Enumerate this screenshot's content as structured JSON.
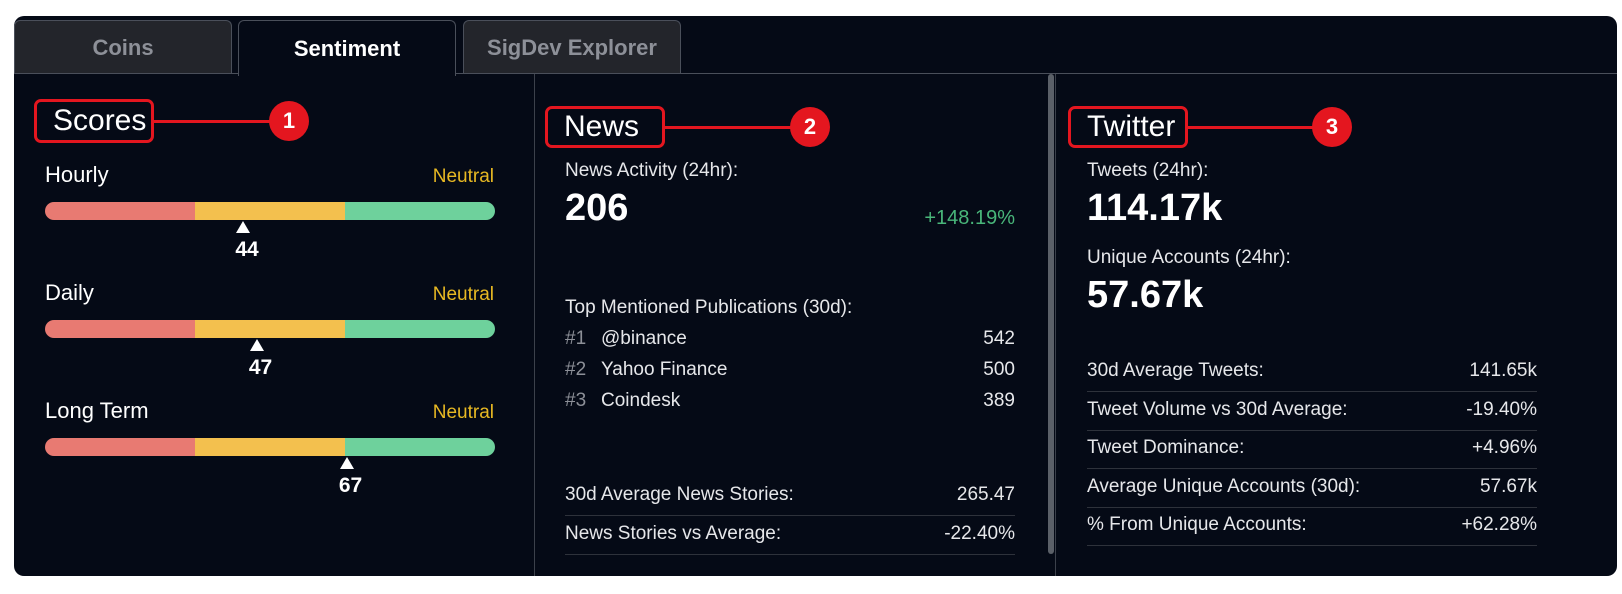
{
  "tabs": [
    {
      "label": "Coins",
      "active": false
    },
    {
      "label": "Sentiment",
      "active": true
    },
    {
      "label": "SigDev Explorer",
      "active": false
    }
  ],
  "colors": {
    "bearish": "#e87a72",
    "neutral": "#f3c04e",
    "bullish": "#6ed19c",
    "accent_red": "#e4161f"
  },
  "scores": {
    "title": "Scores",
    "callout": "1",
    "items": [
      {
        "label": "Hourly",
        "status": "Neutral",
        "value": "44",
        "level": 44
      },
      {
        "label": "Daily",
        "status": "Neutral",
        "value": "47",
        "level": 47
      },
      {
        "label": "Long Term",
        "status": "Neutral",
        "value": "67",
        "level": 67
      }
    ]
  },
  "news": {
    "title": "News",
    "callout": "2",
    "activity_label": "News Activity (24hr):",
    "activity_value": "206",
    "activity_change": "+148.19%",
    "publications_label": "Top Mentioned Publications (30d):",
    "publications": [
      {
        "rank": "#1",
        "name": "@binance",
        "count": "542"
      },
      {
        "rank": "#2",
        "name": "Yahoo Finance",
        "count": "500"
      },
      {
        "rank": "#3",
        "name": "Coindesk",
        "count": "389"
      }
    ],
    "stats": [
      {
        "label": "30d Average News Stories:",
        "value": "265.47",
        "tone": "neutral"
      },
      {
        "label": "News Stories vs Average:",
        "value": "-22.40%",
        "tone": "negative"
      }
    ]
  },
  "twitter": {
    "title": "Twitter",
    "callout": "3",
    "tweets_label": "Tweets (24hr):",
    "tweets_value": "114.17k",
    "accounts_label": "Unique Accounts (24hr):",
    "accounts_value": "57.67k",
    "stats": [
      {
        "label": "30d Average Tweets:",
        "value": "141.65k",
        "tone": "neutral"
      },
      {
        "label": "Tweet Volume vs 30d Average:",
        "value": "-19.40%",
        "tone": "negative"
      },
      {
        "label": "Tweet Dominance:",
        "value": "+4.96%",
        "tone": "positive"
      },
      {
        "label": "Average Unique Accounts (30d):",
        "value": "57.67k",
        "tone": "neutral"
      },
      {
        "label": "% From Unique Accounts:",
        "value": "+62.28%",
        "tone": "positive"
      }
    ]
  }
}
